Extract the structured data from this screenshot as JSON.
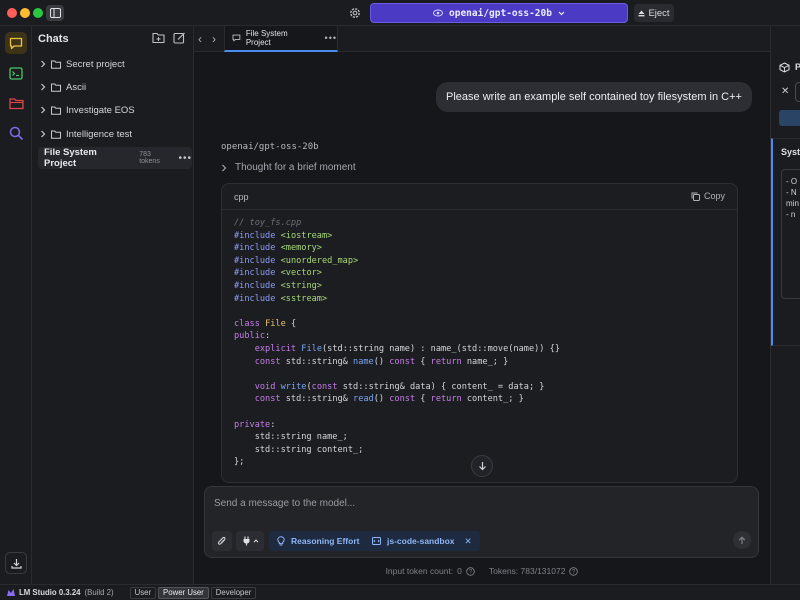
{
  "titlebar": {
    "model_name": "openai/gpt-oss-20b",
    "eject_label": "Eject"
  },
  "chats": {
    "title": "Chats",
    "folders": [
      {
        "label": "Secret project"
      },
      {
        "label": "Ascii"
      },
      {
        "label": "Investigate EOS"
      },
      {
        "label": "Intelligence test"
      }
    ],
    "active_chat": {
      "title": "File System Project",
      "tokens": "783 tokens"
    }
  },
  "tab": {
    "title": "File System Project"
  },
  "conversation": {
    "user_message": "Please write an example self contained toy filesystem in C++",
    "assistant_name": "openai/gpt-oss-20b",
    "thought_label": "Thought for a brief moment",
    "code_lang": "cpp",
    "copy_label": "Copy"
  },
  "composer": {
    "placeholder": "Send a message to the model...",
    "reasoning_chip": "Reasoning Effort",
    "plugin_chip": "js-code-sandbox"
  },
  "tokens": {
    "input_label": "Input token count:",
    "input_value": "0",
    "total_label": "Tokens: 783/131072"
  },
  "right_panel": {
    "title": "P",
    "section_title": "Syste",
    "system_prompt_preview": "- O\n- N\nmin\n- n"
  },
  "statusbar": {
    "app_name": "LM Studio 0.3.24",
    "build": "(Build 2)",
    "modes": [
      "User",
      "Power User",
      "Developer"
    ],
    "active_mode": "Power User"
  },
  "colors": {
    "accent": "#4b3bc4",
    "link_blue": "#4a8cf0",
    "chip_text": "#8eb6f4",
    "background": "#16171b"
  }
}
